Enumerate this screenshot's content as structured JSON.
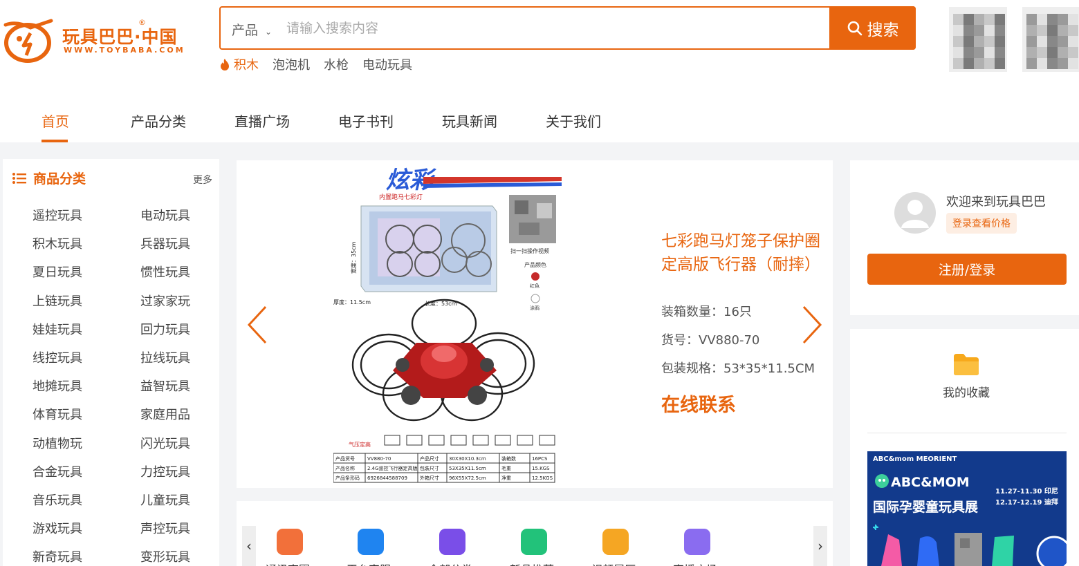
{
  "brand": {
    "name": "玩具巴巴·中国",
    "registered": "®",
    "domain": "WWW.TOYBABA.COM",
    "color": "#e8650f"
  },
  "search": {
    "category": "产品",
    "placeholder": "请输入搜索内容",
    "button": "搜索",
    "hot_tags": [
      "积木",
      "泡泡机",
      "水枪",
      "电动玩具"
    ]
  },
  "nav": {
    "items": [
      "首页",
      "产品分类",
      "直播广场",
      "电子书刊",
      "玩具新闻",
      "关于我们"
    ],
    "active": "首页"
  },
  "sidebar": {
    "title": "商品分类",
    "more": "更多",
    "categories": [
      [
        "遥控玩具",
        "电动玩具"
      ],
      [
        "积木玩具",
        "兵器玩具"
      ],
      [
        "夏日玩具",
        "惯性玩具"
      ],
      [
        "上链玩具",
        "过家家玩"
      ],
      [
        "娃娃玩具",
        "回力玩具"
      ],
      [
        "线控玩具",
        "拉线玩具"
      ],
      [
        "地摊玩具",
        "益智玩具"
      ],
      [
        "体育玩具",
        "家庭用品"
      ],
      [
        "动植物玩",
        "闪光玩具"
      ],
      [
        "合金玩具",
        "力控玩具"
      ],
      [
        "音乐玩具",
        "儿童玩具"
      ],
      [
        "游戏玩具",
        "声控玩具"
      ],
      [
        "新奇玩具",
        "变形玩具"
      ]
    ]
  },
  "banner": {
    "product_title": "七彩跑马灯笼子保护圈定高版飞行器（耐摔）",
    "packing_qty": "装箱数量：16只",
    "item_no": "货号：VV880-70",
    "package_size": "包装规格：53*35*11.5CM",
    "contact": "在线联系",
    "image": {
      "box_brand": "炫彩",
      "box_sub": "内置跑马七彩灯",
      "scan_hint": "扫一扫操作视频",
      "color_label": "产品颜色",
      "color_red": "红色",
      "color_other": "涂鸦",
      "height_label": "宽度：35cm",
      "depth_label": "厚度：11.5cm",
      "length_label": "长度：53cm",
      "feature_label": "气压定高",
      "table": [
        [
          "产品货号",
          "VV880-70",
          "产品尺寸",
          "30X30X10.3cm",
          "装箱数",
          "16PCS"
        ],
        [
          "产品名称",
          "2.4G遥控飞行器定高版",
          "包装尺寸",
          "53X35X11.5cm",
          "毛重",
          "15.KGS"
        ],
        [
          "产品条形码",
          "6926844588709",
          "外箱尺寸",
          "96X55X72.5cm",
          "净重",
          "12.5KGS"
        ]
      ]
    }
  },
  "strip": {
    "items": [
      {
        "label": "通讯商圈",
        "color": "#f2703a"
      },
      {
        "label": "平台客服",
        "color": "#1f84f0"
      },
      {
        "label": "全部分类",
        "color": "#7a4ee8"
      },
      {
        "label": "新品推荐",
        "color": "#22c27a"
      },
      {
        "label": "视频展厅",
        "color": "#f5a623"
      },
      {
        "label": "直播广场",
        "color": "#8a6cf0"
      }
    ]
  },
  "user": {
    "welcome": "欢迎来到玩具巴巴",
    "login_price": "登录查看价格",
    "register_login": "注册/登录",
    "favorites": "我的收藏"
  },
  "ad": {
    "top": "ABC&mom   MEORIENT",
    "brand": "ABC&MOM",
    "title": "国际孕婴童玩具展",
    "dates": [
      "11.27-11.30  印尼",
      "12.17-12.19  迪拜"
    ]
  }
}
